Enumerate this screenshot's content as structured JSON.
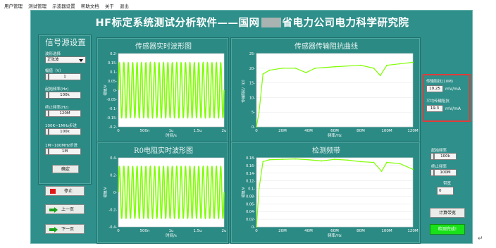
{
  "menu": [
    "用户管理",
    "测试管理",
    "示波器设置",
    "帮助文档",
    "关于",
    "退出"
  ],
  "title_left": "HF标定系统测试分析软件——国网",
  "title_right": "省电力公司电力科学研究院",
  "signal": {
    "heading": "信号源设置",
    "waveform_label": "波形选择",
    "waveform_value": "正弦波",
    "amplitude_label": "幅值（V）",
    "amplitude_value": "1",
    "start_freq_label": "起始频率(Hz)",
    "start_freq_value": "100k",
    "end_freq_label": "终止频率(Hz)",
    "end_freq_value": "120M",
    "step1_label": "100K~1MHz步进",
    "step1_value": "100k",
    "step2_label": "1M~100MHz步进",
    "step2_value": "1M",
    "confirm_label": "确定"
  },
  "buttons": {
    "stop": "停止",
    "prev": "上一页",
    "next": "下一页"
  },
  "plots": {
    "sensor_title": "传感器实时波形图",
    "r0_title": "R0电阻实时波形图",
    "impedance_title": "传感器传输阻抗曲线",
    "band_title": "检测频带",
    "amp_axis": "幅值/V",
    "time_axis": "时间/s",
    "freq_axis": "频率/Hz",
    "imp_axis": "传输阻抗/（Ω）",
    "time_ticks": [
      "0",
      "500n",
      "1u",
      "1.5u",
      "2u"
    ],
    "sensor_yticks": [
      "0.2-",
      "0.15-",
      "0.1-",
      "0.05-",
      "0-",
      "-0.05-",
      "-0.1-",
      "-0.15-",
      "-0.2-"
    ],
    "r0_yticks": [
      "0.4-",
      "0.2-",
      "0-",
      "-0.2-",
      "-0.4-"
    ],
    "freq_ticks": [
      "0",
      "20M",
      "40M",
      "60M",
      "80M",
      "100M",
      "120M"
    ],
    "imp_yticks": [
      "25-",
      "20-",
      "15-",
      "10-",
      "5-",
      "0-"
    ],
    "band_yticks": [
      "0.18-",
      "0.16-",
      "0.14-",
      "0.12-",
      "0.1-",
      "0.08-",
      "0.06-",
      "0.04-",
      "0.02-",
      "0-"
    ]
  },
  "results": {
    "zt_label": "传输阻抗(10M)",
    "zt_value": "19.25",
    "zt_unit": "mV/mA",
    "avg_label": "平均传输阻抗",
    "avg_value": "19.3",
    "avg_unit": "mV/mA"
  },
  "band": {
    "start_label": "起始频率",
    "start_value": "100k",
    "end_label": "终止频率",
    "end_value": "100M",
    "width_label": "带宽",
    "width_value": "0",
    "calc_button": "计算带宽",
    "done_button": "检测完成!"
  },
  "colors": {
    "frame": "#2f8f8a",
    "trace": "#7fff00",
    "done": "#19e019",
    "stop": "#e01818",
    "arrow": "#1aa31a",
    "highlight": "#e23b3b"
  },
  "chart_data": [
    {
      "type": "line",
      "title": "传感器实时波形图",
      "xlabel": "时间/s",
      "ylabel": "幅值/V",
      "xlim": [
        0,
        2e-06
      ],
      "ylim": [
        -0.2,
        0.2
      ],
      "series": [
        {
          "frequency_hz": 12000000.0,
          "amplitude": 0.15
        }
      ]
    },
    {
      "type": "line",
      "title": "R0电阻实时波形图",
      "xlabel": "时间/s",
      "ylabel": "幅值/V",
      "xlim": [
        0,
        2e-06
      ],
      "ylim": [
        -0.4,
        0.4
      ],
      "series": [
        {
          "frequency_hz": 12000000.0,
          "amplitude": 0.3
        }
      ]
    },
    {
      "type": "line",
      "title": "传感器传输阻抗曲线",
      "xlabel": "频率/Hz",
      "ylabel": "传输阻抗/（Ω）",
      "xlim": [
        0,
        120000000.0
      ],
      "ylim": [
        0,
        25
      ],
      "x": [
        0,
        2000000.0,
        5000000.0,
        10000000.0,
        20000000.0,
        30000000.0,
        38000000.0,
        45000000.0,
        60000000.0,
        80000000.0,
        90000000.0,
        95000000.0,
        100000000.0,
        110000000.0,
        120000000.0
      ],
      "y": [
        0,
        5,
        18,
        19.3,
        20,
        20,
        18.5,
        20,
        20.5,
        21,
        20,
        17.5,
        21,
        21.5,
        22
      ]
    },
    {
      "type": "line",
      "title": "检测频带",
      "xlabel": "频率/Hz",
      "ylabel": "幅值/V",
      "xlim": [
        0,
        120000000.0
      ],
      "ylim": [
        0,
        0.18
      ],
      "x": [
        0,
        2000000.0,
        5000000.0,
        10000000.0,
        20000000.0,
        30000000.0,
        40000000.0,
        50000000.0,
        60000000.0,
        70000000.0,
        80000000.0,
        90000000.0,
        96000000.0,
        100000000.0,
        110000000.0,
        120000000.0
      ],
      "y": [
        0,
        0.1,
        0.17,
        0.175,
        0.176,
        0.177,
        0.175,
        0.172,
        0.176,
        0.174,
        0.17,
        0.168,
        0.145,
        0.168,
        0.165,
        0.15
      ]
    }
  ]
}
